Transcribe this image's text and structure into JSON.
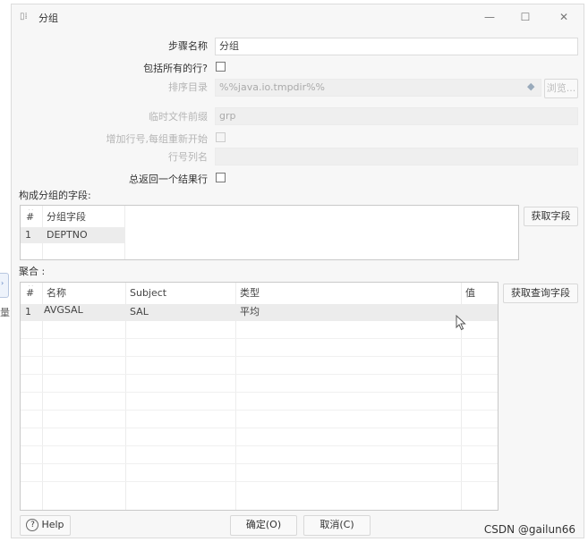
{
  "window": {
    "title": "分组",
    "app_icon": "step-icon",
    "minimize": "—",
    "maximize": "☐",
    "close": "✕"
  },
  "form": {
    "step_name_label": "步骤名称",
    "step_name_value": "分组",
    "include_all_rows_label": "包括所有的行?",
    "sort_dir_label": "排序目录",
    "sort_dir_value": "%%java.io.tmpdir%%",
    "browse_label": "浏览...",
    "temp_prefix_label": "临时文件前缀",
    "temp_prefix_value": "grp",
    "add_line_number_label": "增加行号,每组重新开始",
    "line_number_field_label": "行号列名",
    "always_one_row_label": "总返回一个结果行"
  },
  "group_section": {
    "label": "构成分组的字段:",
    "get_fields_button": "获取字段",
    "columns": [
      "#",
      "分组字段"
    ],
    "rows": [
      {
        "num": "1",
        "field": "DEPTNO"
      }
    ]
  },
  "aggregate_section": {
    "label": "聚合 :",
    "get_lookup_fields_button": "获取查询字段",
    "columns": [
      "#",
      "名称",
      "Subject",
      "类型",
      "值"
    ],
    "rows": [
      {
        "num": "1",
        "name": "AVGSAL",
        "subject": "SAL",
        "type": "平均",
        "value": ""
      }
    ]
  },
  "footer": {
    "help_label": "Help",
    "ok_label": "确定(O)",
    "cancel_label": "取消(C)"
  },
  "side_partial": {
    "text": "量"
  },
  "watermark": "CSDN @gailun66"
}
